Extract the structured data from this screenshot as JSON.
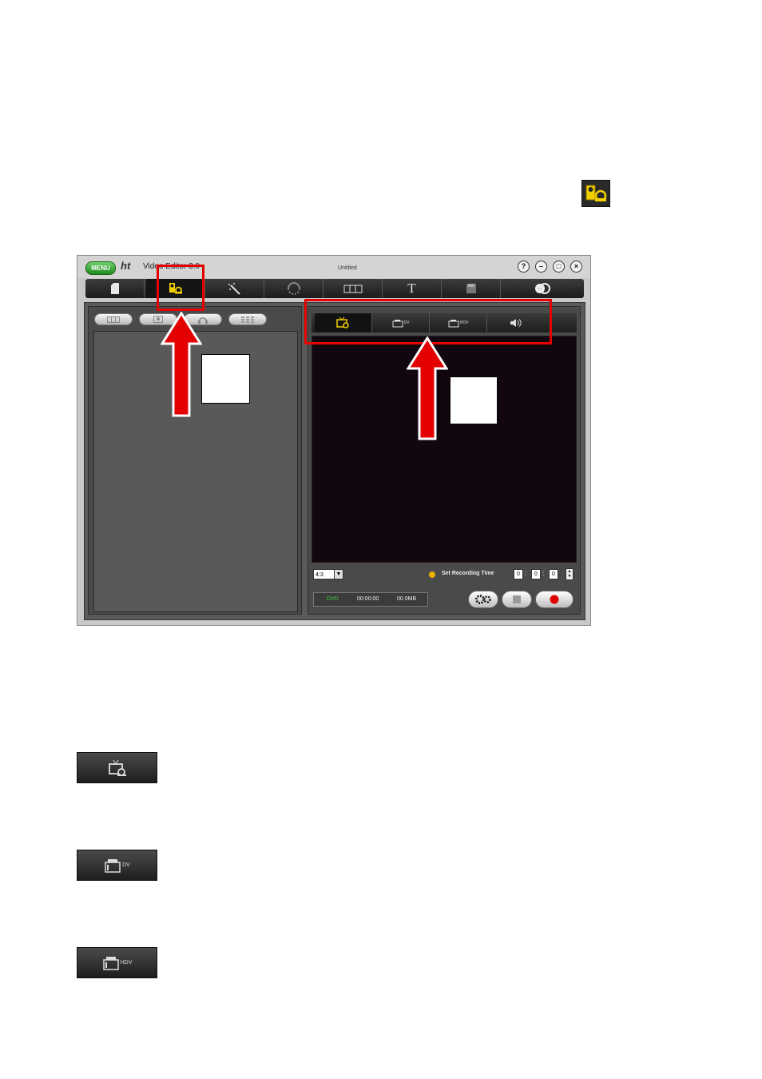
{
  "top_icon": {
    "name": "capture-icon"
  },
  "window": {
    "menu_label": "MENU",
    "logo": "ht",
    "app_name": "Video Editor 3.0",
    "doc_title": "Untitled",
    "window_buttons": [
      "?",
      "–",
      "□",
      "×"
    ]
  },
  "toolbar": {
    "items": [
      "document-icon",
      "capture-icon",
      "magic-wand-icon",
      "transition-icon",
      "timeline-icon",
      "text-icon",
      "save-icon",
      "disc-icon"
    ],
    "text_label": "T"
  },
  "left_panel": {
    "view_buttons": [
      "filmstrip-icon",
      "image-icon",
      "headphones-icon",
      "grid-icon"
    ]
  },
  "source_tabs": [
    {
      "name": "capture-icon",
      "label": ""
    },
    {
      "name": "dv-camera-icon",
      "label": "DV"
    },
    {
      "name": "hdv-camera-icon",
      "label": "HDV"
    },
    {
      "name": "speaker-icon",
      "label": ""
    }
  ],
  "controls": {
    "aspect_ratio": "4:3",
    "recording_label": "Set Recording Time",
    "time_hours": "0",
    "time_minutes": "0",
    "time_seconds": "0",
    "time_separator": ":",
    "status_format": "DVD",
    "status_time": "00:00:00",
    "status_size": "00.0MB"
  },
  "samples": [
    {
      "name": "capture-icon",
      "label": ""
    },
    {
      "name": "dv-camera-icon",
      "label": "DV"
    },
    {
      "name": "hdv-camera-icon",
      "label": "HDV"
    }
  ],
  "colors": {
    "highlight": "#e40000",
    "active_icon": "#f2d000",
    "preview": "#120711"
  }
}
